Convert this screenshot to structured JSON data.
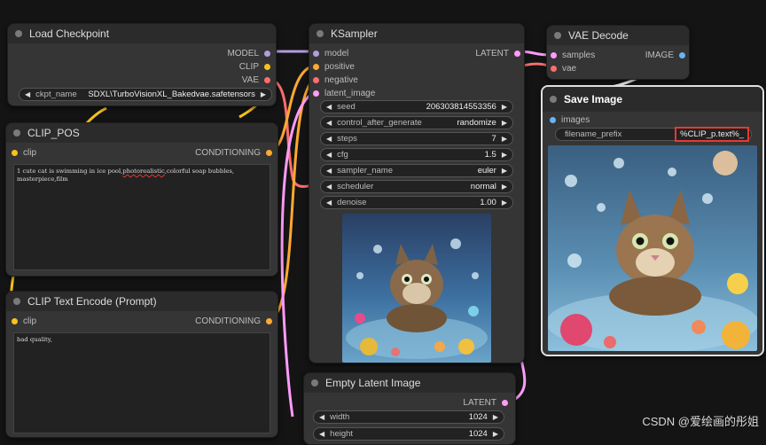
{
  "load_checkpoint": {
    "title": "Load Checkpoint",
    "outputs": [
      "MODEL",
      "CLIP",
      "VAE"
    ],
    "ckpt_label": "ckpt_name",
    "ckpt_value": "SDXL\\TurboVisionXL_Bakedvae.safetensors"
  },
  "clip_pos": {
    "title": "CLIP_POS",
    "input": "clip",
    "output": "CONDITIONING",
    "text_before": "1 cute cat is swimming in ice pool,",
    "text_underlined": "photorealistic",
    "text_after": ",colorful soap bubbles, masterpiece,film"
  },
  "clip_neg": {
    "title": "CLIP Text Encode (Prompt)",
    "input": "clip",
    "output": "CONDITIONING",
    "text": "bad quality,"
  },
  "ksampler": {
    "title": "KSampler",
    "inputs": [
      "model",
      "positive",
      "negative",
      "latent_image"
    ],
    "output": "LATENT",
    "widgets": [
      {
        "label": "seed",
        "value": "206303814553356"
      },
      {
        "label": "control_after_generate",
        "value": "randomize"
      },
      {
        "label": "steps",
        "value": "7"
      },
      {
        "label": "cfg",
        "value": "1.5"
      },
      {
        "label": "sampler_name",
        "value": "euler"
      },
      {
        "label": "scheduler",
        "value": "normal"
      },
      {
        "label": "denoise",
        "value": "1.00"
      }
    ]
  },
  "vae_decode": {
    "title": "VAE Decode",
    "inputs": [
      "samples",
      "vae"
    ],
    "output": "IMAGE"
  },
  "save_image": {
    "title": "Save Image",
    "input": "images",
    "prefix_label": "filename_prefix",
    "prefix_value": "%CLIP_p.text%_"
  },
  "empty_latent": {
    "title": "Empty Latent Image",
    "output": "LATENT",
    "widgets": [
      {
        "label": "width",
        "value": "1024"
      },
      {
        "label": "height",
        "value": "1024"
      }
    ]
  },
  "watermark": "CSDN @爱绘画的彤姐",
  "colors": {
    "model": "#b39ddb",
    "clip": "#f7c31b",
    "vae": "#ff6e6e",
    "conditioning": "#ffa931",
    "latent": "#ff9cf9",
    "image": "#64b5f6",
    "highlight": "#e53935"
  }
}
